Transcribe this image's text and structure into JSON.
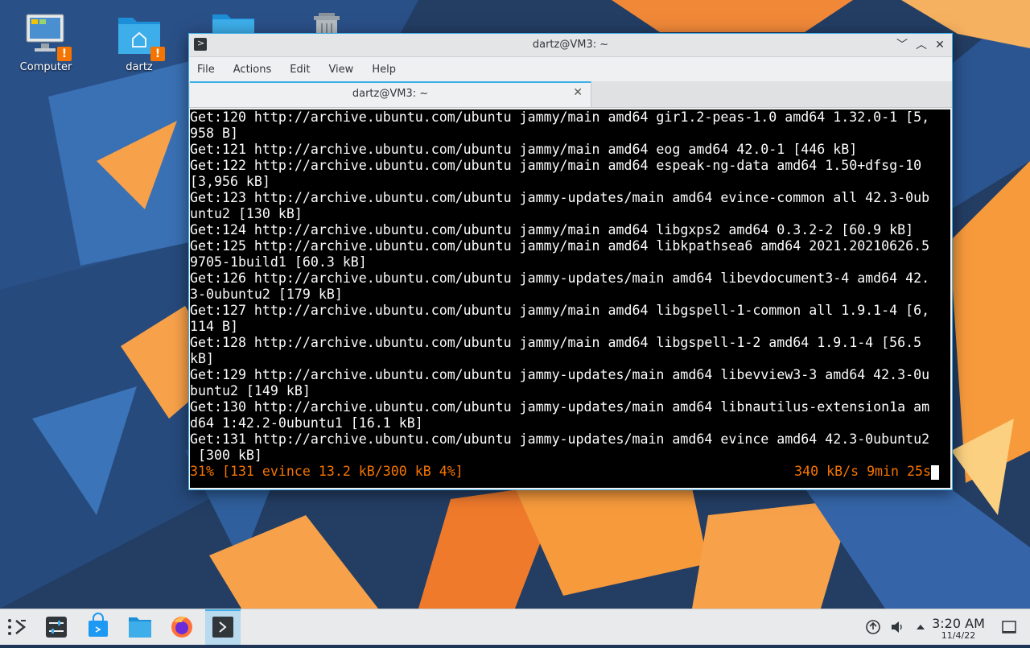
{
  "desktop": {
    "icons": [
      {
        "label": "Computer",
        "icon": "computer-icon"
      },
      {
        "label": "dartz",
        "icon": "home-folder-icon"
      },
      {
        "label": "",
        "icon": "folder-icon"
      },
      {
        "label": "",
        "icon": "trash-icon"
      }
    ],
    "badge_symbol": "!"
  },
  "window": {
    "title": "dartz@VM3: ~",
    "menu": [
      "File",
      "Actions",
      "Edit",
      "View",
      "Help"
    ],
    "tab_label": "dartz@VM3: ~",
    "controls": {
      "minimize": "﹀",
      "maximize": "︿",
      "close": "✕"
    }
  },
  "terminal": {
    "lines": [
      "Get:120 http://archive.ubuntu.com/ubuntu jammy/main amd64 gir1.2-peas-1.0 amd64 1.32.0-1 [5,",
      "958 B]",
      "Get:121 http://archive.ubuntu.com/ubuntu jammy/main amd64 eog amd64 42.0-1 [446 kB]",
      "Get:122 http://archive.ubuntu.com/ubuntu jammy/main amd64 espeak-ng-data amd64 1.50+dfsg-10",
      "[3,956 kB]",
      "Get:123 http://archive.ubuntu.com/ubuntu jammy-updates/main amd64 evince-common all 42.3-0ub",
      "untu2 [130 kB]",
      "Get:124 http://archive.ubuntu.com/ubuntu jammy/main amd64 libgxps2 amd64 0.3.2-2 [60.9 kB]",
      "Get:125 http://archive.ubuntu.com/ubuntu jammy/main amd64 libkpathsea6 amd64 2021.20210626.5",
      "9705-1build1 [60.3 kB]",
      "Get:126 http://archive.ubuntu.com/ubuntu jammy-updates/main amd64 libevdocument3-4 amd64 42.",
      "3-0ubuntu2 [179 kB]",
      "Get:127 http://archive.ubuntu.com/ubuntu jammy/main amd64 libgspell-1-common all 1.9.1-4 [6,",
      "114 B]",
      "Get:128 http://archive.ubuntu.com/ubuntu jammy/main amd64 libgspell-1-2 amd64 1.9.1-4 [56.5",
      "kB]",
      "Get:129 http://archive.ubuntu.com/ubuntu jammy-updates/main amd64 libevview3-3 amd64 42.3-0u",
      "buntu2 [149 kB]",
      "Get:130 http://archive.ubuntu.com/ubuntu jammy-updates/main amd64 libnautilus-extension1a am",
      "d64 1:42.2-0ubuntu1 [16.1 kB]",
      "Get:131 http://archive.ubuntu.com/ubuntu jammy-updates/main amd64 evince amd64 42.3-0ubuntu2",
      " [300 kB]"
    ],
    "status_left": "31% [131 evince 13.2 kB/300 kB 4%]",
    "status_right": "340 kB/s 9min 25s",
    "status_color": "#f67400"
  },
  "taskbar": {
    "apps": [
      {
        "name": "application-launcher-icon"
      },
      {
        "name": "system-settings-icon"
      },
      {
        "name": "discover-store-icon"
      },
      {
        "name": "file-manager-icon"
      },
      {
        "name": "firefox-icon"
      },
      {
        "name": "konsole-icon",
        "active": true
      }
    ],
    "tray": [
      "network-updates-icon",
      "volume-icon",
      "expand-tray-icon"
    ],
    "clock_time": "3:20 AM",
    "clock_date": "11/4/22"
  },
  "colors": {
    "accent": "#3daee9",
    "warning": "#f67400"
  }
}
